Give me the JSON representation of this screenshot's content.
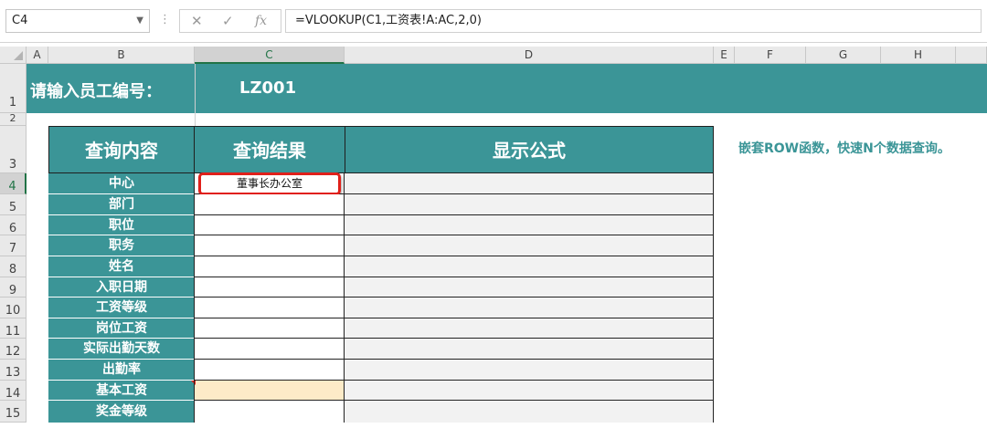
{
  "formula_bar": {
    "name_box": "C4",
    "formula": "=VLOOKUP(C1,工资表!A:AC,2,0)"
  },
  "columns": [
    "A",
    "B",
    "C",
    "D",
    "E",
    "F",
    "G",
    "H"
  ],
  "row_numbers": [
    "1",
    "2",
    "3",
    "4",
    "5",
    "6",
    "7",
    "8",
    "9",
    "10",
    "11",
    "12",
    "13",
    "14",
    "15"
  ],
  "banner": {
    "prompt": "请输入员工编号：",
    "employee_id": "LZ001"
  },
  "table": {
    "headers": [
      "查询内容",
      "查询结果",
      "显示公式"
    ],
    "items": [
      "中心",
      "部门",
      "职位",
      "职务",
      "姓名",
      "入职日期",
      "工资等级",
      "岗位工资",
      "实际出勤天数",
      "出勤率",
      "基本工资",
      "奖金等级"
    ],
    "result_c4": "董事长办公室"
  },
  "note": "嵌套ROW函数，快速N个数据查询。",
  "colors": {
    "teal": "#3b9597",
    "highlight_red": "#e0201a",
    "note_text": "#3b9597",
    "selected_accent": "#217346",
    "cell_yellow": "#fdebc8"
  }
}
